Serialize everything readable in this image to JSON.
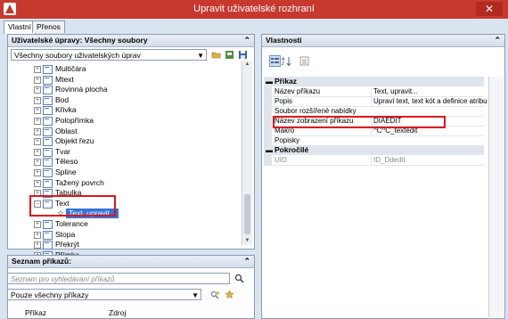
{
  "window": {
    "title": "Upravit uživatelské rozhraní",
    "close": "✕"
  },
  "tabs": [
    {
      "label": "Vlastní"
    },
    {
      "label": "Přenos"
    }
  ],
  "left_panel": {
    "header": "Uživatelské úpravy: Všechny soubory",
    "collapse": "⌃",
    "file_combo": "Všechny soubory uživatelských úprav",
    "tree": [
      "Multičára",
      "Mtext",
      "Rovinná plocha",
      "Bod",
      "Křivka",
      "Polopřímka",
      "Oblast",
      "Objekt řezu",
      "Tvar",
      "Těleso",
      "Spline",
      "Tažený povrch",
      "Tabulka",
      "Text",
      "Tolerance",
      "Stopa",
      "Překrýt",
      "Přímka"
    ],
    "selected_child": "Text, upravit..."
  },
  "commands_panel": {
    "header": "Seznam příkazů:",
    "collapse": "⌃",
    "search_placeholder": "Seznam pro vyhledávání příkazů",
    "filter_combo": "Pouze všechny příkazy",
    "columns": [
      "Příkaz",
      "Zdroj"
    ]
  },
  "properties_panel": {
    "header": "Vlastnosti",
    "collapse": "⌃",
    "categories": [
      {
        "name": "Příkaz",
        "rows": [
          {
            "name": "Název příkazu",
            "value": "Text, upravit..."
          },
          {
            "name": "Popis",
            "value": "Upraví text, text kót a definice atributů."
          },
          {
            "name": "Soubor rozšířené nabídky",
            "value": ""
          },
          {
            "name": "Název zobrazení příkazu",
            "value": "DIAEDIT"
          },
          {
            "name": "Makro",
            "value": "^C^C_textedit"
          },
          {
            "name": "Popisky",
            "value": ""
          }
        ]
      },
      {
        "name": "Pokročilé",
        "rows": [
          {
            "name": "UID",
            "value": "ID_Ddedit"
          }
        ]
      }
    ]
  },
  "colors": {
    "titlebar": "#c7392e",
    "selection": "#3574d8",
    "highlight": "#e0141b"
  }
}
